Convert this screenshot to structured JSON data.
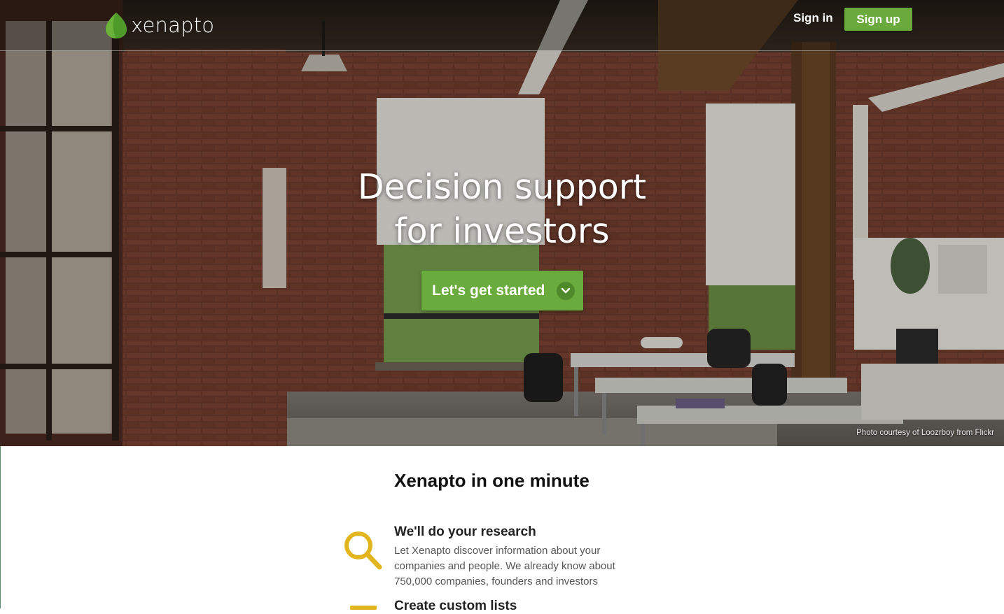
{
  "brand": {
    "name": "xenapto",
    "accent": "#6aab3d",
    "icon": "leaf-icon"
  },
  "nav": {
    "signin_label": "Sign in",
    "signup_label": "Sign up"
  },
  "hero": {
    "headline_line1": "Decision support",
    "headline_line2": "for investors",
    "cta_label": "Let's get started",
    "cta_icon": "chevron-down-icon",
    "photo_credit": "Photo courtesy of Loozrboy from Flickr"
  },
  "section": {
    "title": "Xenapto in one minute",
    "features": [
      {
        "icon": "search-icon",
        "title": "We'll do your research",
        "desc": "Let Xenapto discover information about your companies and people. We already know about 750,000 companies, founders and investors"
      },
      {
        "icon": "list-icon",
        "title": "Create custom lists"
      }
    ]
  },
  "colors": {
    "feature_icon": "#e2b51e",
    "button": "#6aab3d"
  }
}
